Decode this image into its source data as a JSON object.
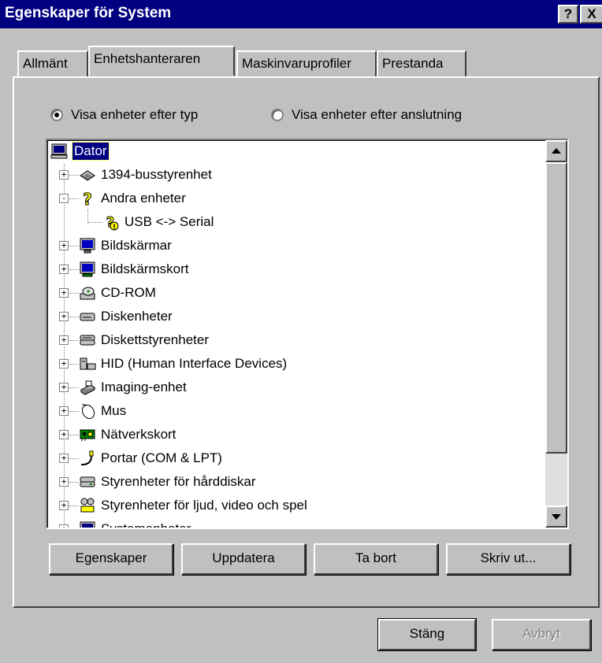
{
  "window": {
    "title": "Egenskaper för System",
    "help_label": "?",
    "close_label": "X"
  },
  "tabs": [
    {
      "label": "Allmänt",
      "active": false
    },
    {
      "label": "Enhetshanteraren",
      "active": true
    },
    {
      "label": "Maskinvaruprofiler",
      "active": false
    },
    {
      "label": "Prestanda",
      "active": false
    }
  ],
  "view_options": {
    "by_type": {
      "label": "Visa enheter efter typ",
      "selected": true
    },
    "by_connection": {
      "label": "Visa enheter efter anslutning",
      "selected": false
    }
  },
  "device_tree": [
    {
      "label": "Dator",
      "icon": "computer-icon",
      "selected": true
    },
    {
      "label": "1394-busstyrenhet",
      "icon": "bus-controller-icon",
      "expander": "+"
    },
    {
      "label": "Andra enheter",
      "icon": "question-mark-icon",
      "expander": "-"
    },
    {
      "label": "USB <-> Serial",
      "icon": "unknown-device-warning-icon"
    },
    {
      "label": "Bildskärmar",
      "icon": "monitor-icon",
      "expander": "+"
    },
    {
      "label": "Bildskärmskort",
      "icon": "display-adapter-icon",
      "expander": "+"
    },
    {
      "label": "CD-ROM",
      "icon": "cdrom-icon",
      "expander": "+"
    },
    {
      "label": "Diskenheter",
      "icon": "disk-drive-icon",
      "expander": "+"
    },
    {
      "label": "Diskettstyrenheter",
      "icon": "floppy-controller-icon",
      "expander": "+"
    },
    {
      "label": "HID (Human Interface Devices)",
      "icon": "hid-icon",
      "expander": "+"
    },
    {
      "label": "Imaging-enhet",
      "icon": "scanner-icon",
      "expander": "+"
    },
    {
      "label": "Mus",
      "icon": "mouse-icon",
      "expander": "+"
    },
    {
      "label": "Nätverkskort",
      "icon": "network-card-icon",
      "expander": "+"
    },
    {
      "label": "Portar (COM & LPT)",
      "icon": "port-icon",
      "expander": "+"
    },
    {
      "label": "Styrenheter för hårddiskar",
      "icon": "hdd-controller-icon",
      "expander": "+"
    },
    {
      "label": "Styrenheter för ljud, video och spel",
      "icon": "sound-video-icon",
      "expander": "+"
    },
    {
      "label": "Systemenheter",
      "icon": "system-device-icon",
      "expander": "+"
    }
  ],
  "actions": {
    "properties": "Egenskaper",
    "refresh": "Uppdatera",
    "remove": "Ta bort",
    "print": "Skriv ut..."
  },
  "dialog_buttons": {
    "close": "Stäng",
    "cancel": "Avbryt"
  },
  "colors": {
    "titlebar": "#000080",
    "face": "#c0c0c0",
    "selection": "#000080"
  }
}
